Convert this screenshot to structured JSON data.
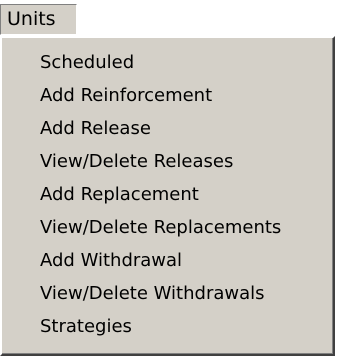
{
  "menu": {
    "title": "Units",
    "items": [
      {
        "label": "Scheduled"
      },
      {
        "label": "Add Reinforcement"
      },
      {
        "label": "Add Release"
      },
      {
        "label": "View/Delete Releases"
      },
      {
        "label": "Add Replacement"
      },
      {
        "label": "View/Delete Replacements"
      },
      {
        "label": "Add Withdrawal"
      },
      {
        "label": "View/Delete Withdrawals"
      },
      {
        "label": "Strategies"
      }
    ]
  }
}
